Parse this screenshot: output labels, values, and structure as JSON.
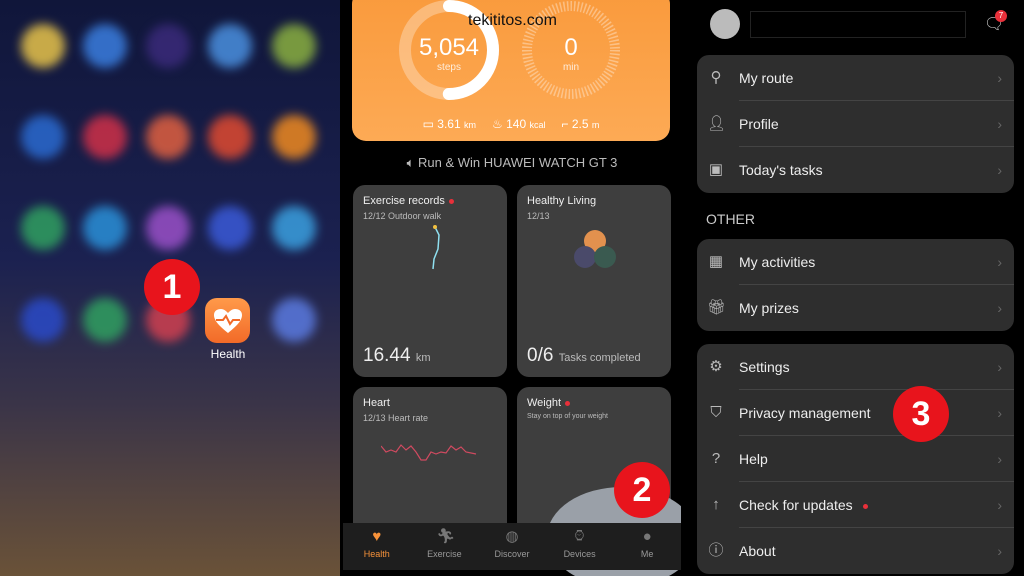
{
  "watermark": "tekititos.com",
  "launcher": {
    "health_app_label": "Health",
    "step_badge": "1",
    "app_colors": [
      "#e8c44a",
      "#3a7ee0",
      "#3a2a7a",
      "#4a90e0",
      "#8ab040",
      "#2a6ad0",
      "#d03048",
      "#e06040",
      "#e04a30",
      "#f08a20",
      "#30a060",
      "#2a90d8",
      "#9a50c8",
      "#3a5ad8",
      "#3aa0e0",
      "#2a4ac8",
      "#30a060",
      "#d04050",
      "#5a7ae0"
    ]
  },
  "activity": {
    "steps": "5,054",
    "steps_unit": "steps",
    "steps_progress": 0.5,
    "minutes": "0",
    "minutes_unit": "min",
    "distance": "3.61",
    "distance_unit": "km",
    "calories": "140",
    "calories_unit": "kcal",
    "climb": "2.5",
    "climb_unit": "m"
  },
  "promo": "Run & Win HUAWEI WATCH GT 3",
  "cards": {
    "exercise": {
      "title": "Exercise records",
      "date": "12/12",
      "type": "Outdoor walk",
      "value": "16.44",
      "unit": "km"
    },
    "healthy": {
      "title": "Healthy Living",
      "date": "12/13",
      "value": "0/6",
      "unit": "Tasks completed"
    },
    "heart": {
      "title": "Heart",
      "date": "12/13",
      "type": "Heart rate"
    },
    "weight": {
      "title": "Weight",
      "subtitle": "Stay on top of your weight"
    }
  },
  "step_badge_2": "2",
  "nav": [
    {
      "label": "Health",
      "icon": "heart-icon",
      "active": true
    },
    {
      "label": "Exercise",
      "icon": "run-icon"
    },
    {
      "label": "Discover",
      "icon": "globe-icon"
    },
    {
      "label": "Devices",
      "icon": "watch-icon"
    },
    {
      "label": "Me",
      "icon": "avatar-icon"
    }
  ],
  "me": {
    "message_count": "7",
    "group1": [
      {
        "label": "My route",
        "icon": "route-icon"
      },
      {
        "label": "Profile",
        "icon": "profile-icon"
      },
      {
        "label": "Today's tasks",
        "icon": "tasks-icon"
      }
    ],
    "section": "OTHER",
    "group2": [
      {
        "label": "My activities",
        "icon": "calendar-icon"
      },
      {
        "label": "My prizes",
        "icon": "gift-icon"
      }
    ],
    "group3": [
      {
        "label": "Settings",
        "icon": "gear-icon"
      },
      {
        "label": "Privacy management",
        "icon": "shield-icon"
      },
      {
        "label": "Help",
        "icon": "help-icon"
      },
      {
        "label": "Check for updates",
        "icon": "update-icon",
        "dot": true
      },
      {
        "label": "About",
        "icon": "info-icon"
      }
    ]
  },
  "step_badge_3": "3",
  "colors": {
    "accent": "#f7923a",
    "badge": "#e8141c"
  }
}
